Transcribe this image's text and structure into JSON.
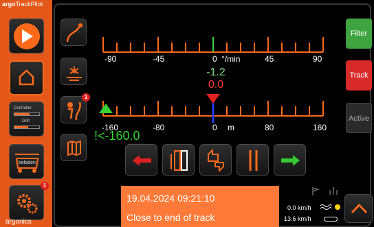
{
  "brand": {
    "prefix": "argo",
    "name": "TrackPilot",
    "footer": "argonics"
  },
  "left_nav": [
    {
      "name": "play-icon"
    },
    {
      "name": "home-icon"
    },
    {
      "name": "controller-drift-icon",
      "line1": "Controller",
      "line2": "Drift"
    },
    {
      "name": "beladen-icon",
      "label": "beladen"
    },
    {
      "name": "gears-icon",
      "badge": "1"
    }
  ],
  "tools": [
    {
      "name": "curve-track-icon"
    },
    {
      "name": "sun-field-icon"
    },
    {
      "name": "person-curve-icon",
      "badge": "1"
    },
    {
      "name": "map-icon"
    }
  ],
  "rate_scale": {
    "labels": [
      "-90",
      "-45",
      "0",
      "°/min",
      "45",
      "90"
    ],
    "value": "-1.2",
    "value_color": "#7fe07f"
  },
  "offset": {
    "value": "0.0",
    "value_color": "#ff3a3a",
    "labels": [
      "-160",
      "-80",
      "0",
      "m",
      "80",
      "160"
    ],
    "limit_text": "!<-160.0",
    "limit_color": "#35d335"
  },
  "actions": [
    {
      "name": "arrow-left-icon"
    },
    {
      "name": "tramline-icon"
    },
    {
      "name": "thumbs-icon"
    },
    {
      "name": "shovel-tools-icon"
    },
    {
      "name": "arrow-right-icon"
    }
  ],
  "message": {
    "timestamp": "19.04.2024 09:21:10",
    "text": "Close to end of track"
  },
  "status": {
    "speed1": "0.0 km/h",
    "speed2": "13.6 km/h"
  },
  "side_buttons": {
    "filter": "Filter",
    "track": "Track",
    "active": "Active"
  },
  "colors": {
    "accent": "#ff6a1a",
    "filter": "#3fa33f",
    "track": "#d92a2a",
    "message_bg": "#ff7a38"
  }
}
